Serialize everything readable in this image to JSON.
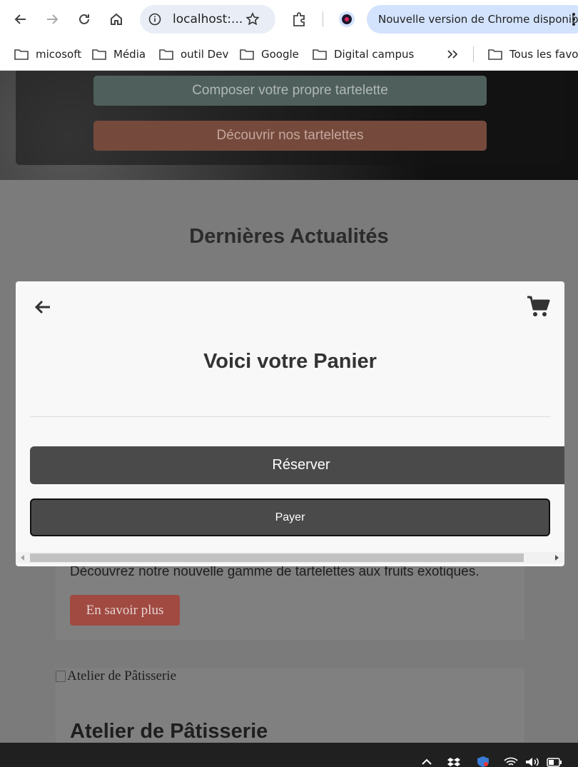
{
  "browser": {
    "address": "localhost:...",
    "update_text": "Nouvelle version de Chrome disponible",
    "bookmarks": [
      "micosoft",
      "Média",
      "outil Dev",
      "Google",
      "Digital campus"
    ],
    "all_bookmarks": "Tous les favoris"
  },
  "hero": {
    "compose_label": "Composer votre propre tartelette",
    "discover_label": "Découvrir nos tartelettes"
  },
  "news": {
    "section_title": "Dernières Actualités",
    "card1_text": "Découvrez notre nouvelle gamme de tartelettes aux fruits exotiques.",
    "card1_button": "En savoir plus",
    "card2_img_alt": "Atelier de Pâtisserie",
    "card2_title": "Atelier de Pâtisserie"
  },
  "modal": {
    "title": "Voici votre Panier",
    "reserve_label": "Réserver",
    "pay_label": "Payer"
  }
}
